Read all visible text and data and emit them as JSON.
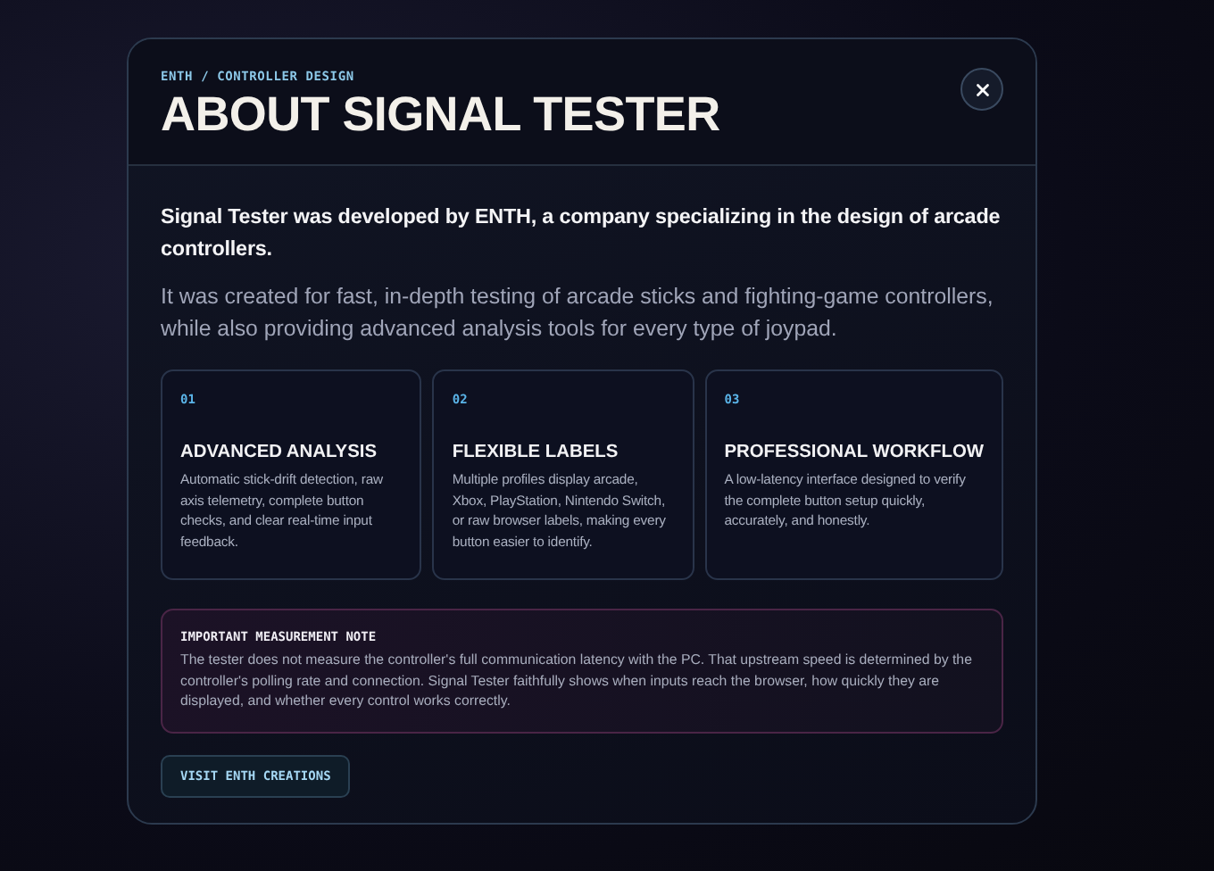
{
  "dialog": {
    "eyebrow": "ENTH / CONTROLLER DESIGN",
    "title": "ABOUT SIGNAL TESTER"
  },
  "intro": "Signal Tester was developed by ENTH, a company specializing in the design of arcade controllers.",
  "description": "It was created for fast, in-depth testing of arcade sticks and fighting-game controllers, while also providing advanced analysis tools for every type of joypad.",
  "features": [
    {
      "number": "01",
      "title": "ADVANCED ANALYSIS",
      "text": "Automatic stick-drift detection, raw axis telemetry, complete button checks, and clear real-time input feedback."
    },
    {
      "number": "02",
      "title": "FLEXIBLE LABELS",
      "text": "Multiple profiles display arcade, Xbox, PlayStation, Nintendo Switch, or raw browser labels, making every button easier to identify."
    },
    {
      "number": "03",
      "title": "PROFESSIONAL WORKFLOW",
      "text": "A low-latency interface designed to verify the complete button setup quickly, accurately, and honestly."
    }
  ],
  "note": {
    "title": "IMPORTANT MEASUREMENT NOTE",
    "text": "The tester does not measure the controller's full communication latency with the PC. That upstream speed is determined by the controller's polling rate and connection. Signal Tester faithfully shows when inputs reach the browser, how quickly they are displayed, and whether every control works correctly."
  },
  "link_button": "VISIT ENTH CREATIONS"
}
